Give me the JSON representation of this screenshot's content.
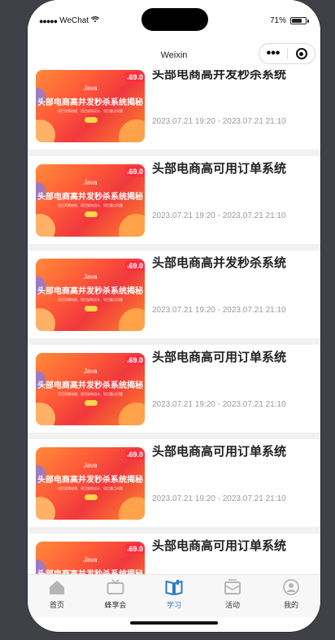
{
  "status_bar": {
    "carrier": "WeChat",
    "battery_percent": "71%",
    "battery_level": 0.71
  },
  "nav": {
    "title": "Weixin"
  },
  "courses": [
    {
      "title": "头部电商高并发秒杀系统",
      "time": "2023.07.21 19:20 - 2023.07.21 21:10"
    },
    {
      "title": "头部电商高可用订单系统",
      "time": "2023.07.21 19:20 - 2023.07.21 21:10"
    },
    {
      "title": "头部电商高并发秒杀系统",
      "time": "2023.07.21 19:20 - 2023.07.21 21:10"
    },
    {
      "title": "头部电商高可用订单系统",
      "time": "2023.07.21 19:20 - 2023.07.21 21:10"
    },
    {
      "title": "头部电商高可用订单系统",
      "time": "2023.07.21 19:20 - 2023.07.21 21:10"
    },
    {
      "title": "头部电商高可用订单系统",
      "time": ""
    }
  ],
  "thumbnail": {
    "price": "69.0",
    "language": "Java",
    "headline": "头部电商高并发秒杀系统揭秘",
    "subtitle": "项目背景梳理、项目架构设计、项目重点问题",
    "accent_colors": [
      "#ff5a38",
      "#f0383d",
      "#ffb267"
    ]
  },
  "tabs": [
    {
      "label": "首页",
      "icon": "home-icon"
    },
    {
      "label": "蜂享会",
      "icon": "tv-icon"
    },
    {
      "label": "学习",
      "icon": "book-icon",
      "active": true
    },
    {
      "label": "活动",
      "icon": "envelope-icon"
    },
    {
      "label": "我的",
      "icon": "profile-icon"
    }
  ],
  "colors": {
    "active_tab": "#2a7dc2",
    "inactive_icon": "#b5b5b5"
  }
}
